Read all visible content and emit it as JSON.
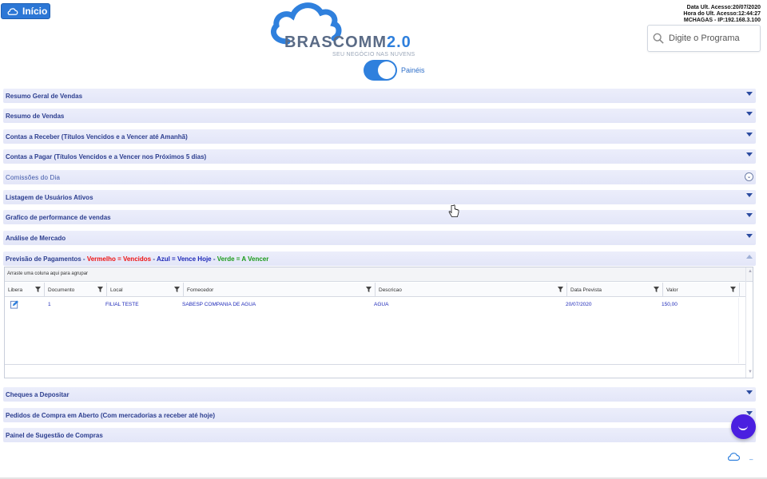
{
  "header": {
    "home_button": "Início",
    "logo_main": "BRASCOMM",
    "logo_version": "2.0",
    "logo_tagline": "SEU NEGÓCIO NAS NUVENS",
    "toggle_label": "Painéis",
    "toggle_on": true,
    "access_info": {
      "date_line": "Data Ult. Acesso:20/07/2020",
      "time_line": "Hora do Ult. Acesso:12:44:27",
      "user_line": "MCHAGAS - IP:192.168.3.100"
    },
    "search": {
      "placeholder": "Digite o Programa"
    }
  },
  "panels": [
    {
      "title": "Resumo Geral de Vendas"
    },
    {
      "title": "Resumo de Vendas"
    },
    {
      "title": "Contas a Receber (Títulos Vencidos e a Vencer até Amanhã)"
    },
    {
      "title": "Contas a Pagar (Títulos Vencidos e a Vencer nos Próximos 5 dias)"
    },
    {
      "title": "Comissões do Dia"
    },
    {
      "title": "Listagem de Usuários Ativos"
    },
    {
      "title": "Grafico de performance de vendas"
    },
    {
      "title": "Análise de Mercado"
    }
  ],
  "payments_panel": {
    "title": "Previsão de Pagamentos -",
    "legend_red": "Vermelho = Vencidos",
    "sep1": "-",
    "legend_blue": "Azul = Vence Hoje",
    "sep2": "-",
    "legend_green": "Verde = A Vencer",
    "group_hint": "Arraste uma coluna aqui para agrupar",
    "columns": [
      "Libera",
      "Documento",
      "Local",
      "Fornecedor",
      "Descricao",
      "Data Prevista",
      "Valor"
    ],
    "rows": [
      {
        "documento": "1",
        "local": "FILIAL TESTE",
        "fornecedor": "SABESP COMPANIA DE AGUA",
        "descricao": "AGUA",
        "data_prevista": "20/07/2020",
        "valor": "150,00"
      }
    ]
  },
  "lower_panels": [
    {
      "title": "Cheques a Depositar"
    },
    {
      "title": "Pedidos de Compra em Aberto (Com mercadorias a receber até hoje)"
    },
    {
      "title": "Painel de Sugestão de Compras"
    }
  ],
  "colors": {
    "accent": "#2f80dd",
    "panel_title": "#2c3e8f",
    "chat": "#4a1fe0"
  }
}
